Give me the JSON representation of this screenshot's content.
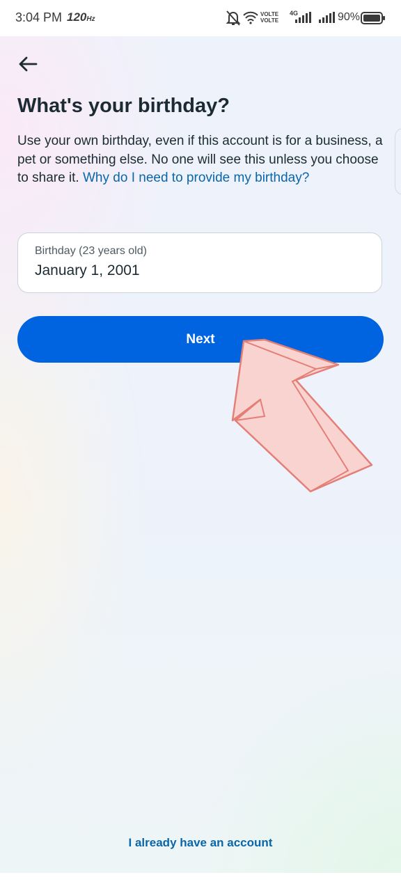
{
  "status_bar": {
    "time": "3:04 PM",
    "refresh_rate": "120",
    "refresh_unit": "Hz",
    "volte_top": "VOLTE",
    "volte_bottom": "VOLTE",
    "network": "4G",
    "battery": "90%"
  },
  "header": {
    "back_icon": "arrow-left-icon"
  },
  "page": {
    "title": "What's your birthday?",
    "description": "Use your own birthday, even if this account is for a business, a pet or something else. No one will see this unless you choose to share it.",
    "help_link": "Why do I need to provide my birthday?"
  },
  "birthday_field": {
    "label": "Birthday (23 years old)",
    "value": "January 1, 2001"
  },
  "actions": {
    "next_label": "Next",
    "login_link": "I already have an account"
  },
  "colors": {
    "primary_button": "#0064e0",
    "link": "#0a66a8",
    "text": "#1c2b33",
    "annotation_arrow": "#f7c9c4"
  }
}
